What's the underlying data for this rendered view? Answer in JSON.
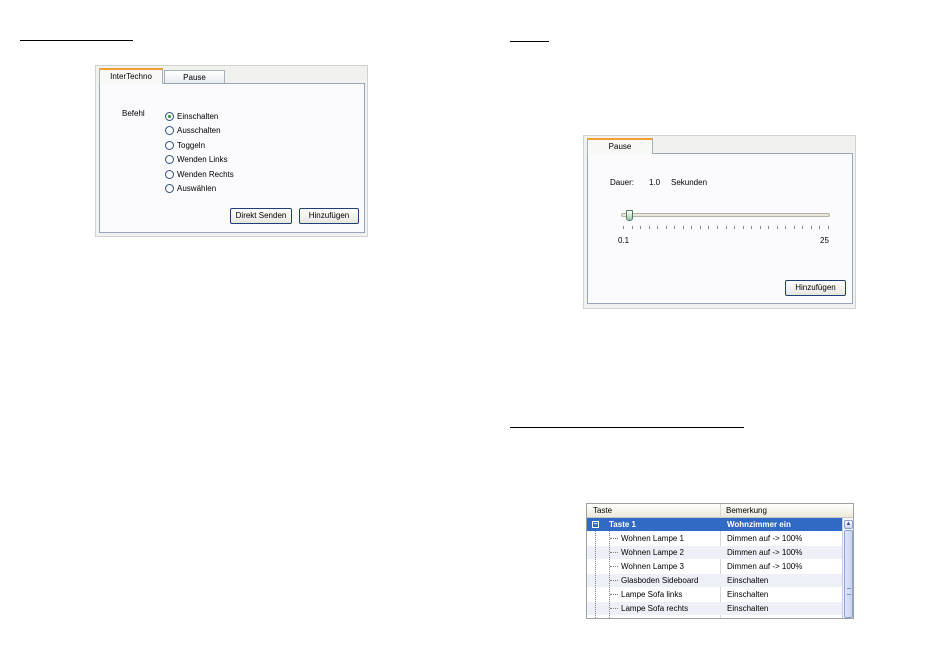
{
  "intertechno_dialog": {
    "tabs": [
      {
        "label": "InterTechno",
        "active": true
      },
      {
        "label": "Pause",
        "active": false
      }
    ],
    "befehl_label": "Befehl",
    "options": [
      {
        "label": "Einschalten",
        "checked": true
      },
      {
        "label": "Ausschalten",
        "checked": false
      },
      {
        "label": "Toggeln",
        "checked": false
      },
      {
        "label": "Wenden Links",
        "checked": false
      },
      {
        "label": "Wenden Rechts",
        "checked": false
      },
      {
        "label": "Auswählen",
        "checked": false
      }
    ],
    "send_label": "Direkt Senden",
    "add_label": "Hinzufügen"
  },
  "pause_dialog": {
    "tab_label": "Pause",
    "duration_label": "Dauer:",
    "duration_value": "1.0",
    "duration_unit": "Sekunden",
    "slider": {
      "min": 0.1,
      "max": 25,
      "value": 1.0,
      "min_label": "0.1",
      "max_label": "25"
    },
    "add_label": "Hinzufügen"
  },
  "key_grid": {
    "columns": [
      "Taste",
      "Bemerkung"
    ],
    "rows": [
      {
        "taste": "Taste 1",
        "bemerkung": "Wohnzimmer ein",
        "selected": true,
        "level": 0
      },
      {
        "taste": "Wohnen Lampe 1",
        "bemerkung": "Dimmen auf -> 100%",
        "level": 1
      },
      {
        "taste": "Wohnen Lampe 2",
        "bemerkung": "Dimmen auf -> 100%",
        "level": 1
      },
      {
        "taste": "Wohnen Lampe 3",
        "bemerkung": "Dimmen auf -> 100%",
        "level": 1
      },
      {
        "taste": "Glasboden Sideboard",
        "bemerkung": "Einschalten",
        "level": 1
      },
      {
        "taste": "Lampe Sofa links",
        "bemerkung": "Einschalten",
        "level": 1
      },
      {
        "taste": "Lampe Sofa rechts",
        "bemerkung": "Einschalten",
        "level": 1
      }
    ],
    "scroll_up_icon": "chevron-up-icon",
    "scroll_grip_icon": "grip-icon"
  },
  "colors": {
    "selection": "#316ac5",
    "tab_accent": "#f0a030",
    "button_border": "#1f3f7a"
  }
}
